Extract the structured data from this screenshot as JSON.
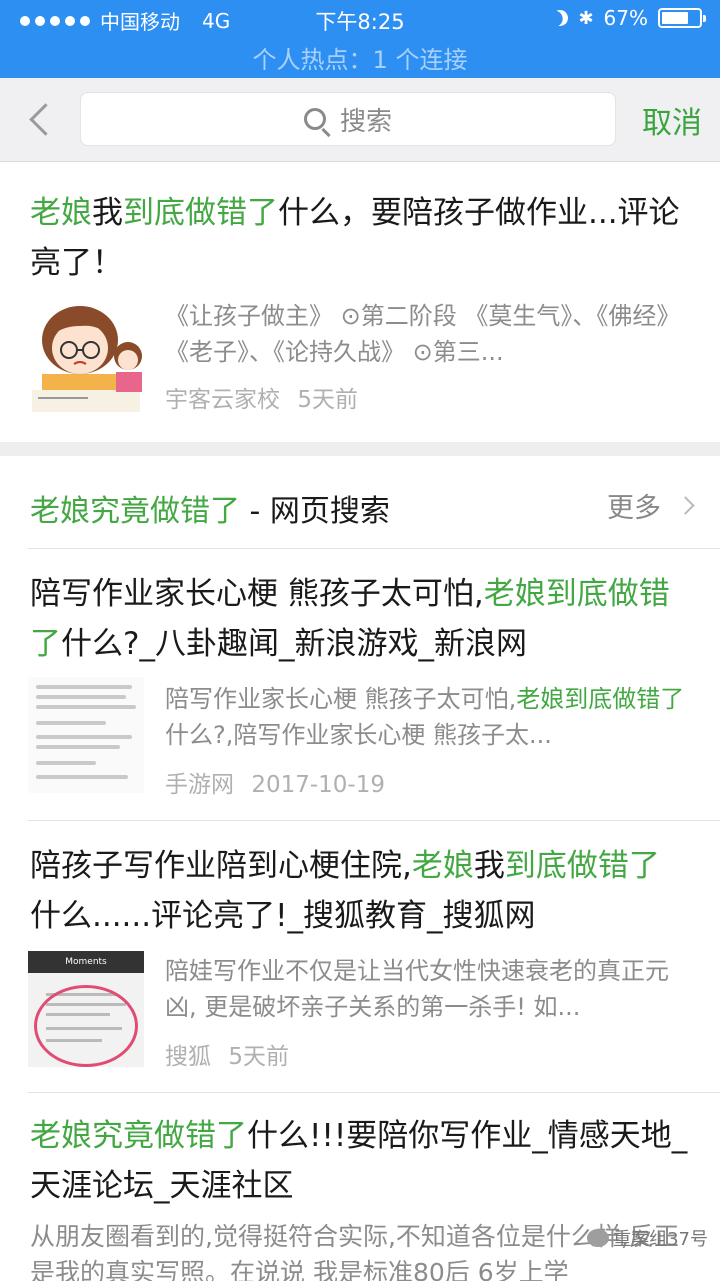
{
  "status_bar": {
    "carrier": "中国移动",
    "network": "4G",
    "time": "下午8:25",
    "battery": "67%",
    "battery_level": 0.67,
    "hotspot": "个人热点：1 个连接"
  },
  "search": {
    "placeholder": "搜索",
    "cancel_label": "取消"
  },
  "result1": {
    "title": [
      {
        "t": "老娘",
        "hl": true
      },
      {
        "t": "我",
        "hl": false
      },
      {
        "t": "到底做错了",
        "hl": true
      },
      {
        "t": "什么，要陪孩子做作业...评论亮了！",
        "hl": false
      }
    ],
    "snippet": "《让孩子做主》 ⊙第二阶段 《莫生气》、《佛经》《老子》、《论持久战》 ⊙第三...",
    "source": "宇客云家校",
    "time": "5天前"
  },
  "web_section": {
    "title_hl": "老娘究竟做错了",
    "title_rest": " - 网页搜索",
    "more_label": "更多"
  },
  "result2": {
    "title": [
      {
        "t": "陪写作业家长心梗 熊孩子太可怕,",
        "hl": false
      },
      {
        "t": "老娘到底做错了",
        "hl": true
      },
      {
        "t": "什么?_八卦趣闻_新浪游戏_新浪网",
        "hl": false
      }
    ],
    "snippet": [
      {
        "t": "陪写作业家长心梗 熊孩子太可怕,",
        "hl": false
      },
      {
        "t": "老娘到底做错了",
        "hl": true
      },
      {
        "t": "什么?,陪写作业家长心梗 熊孩子太...",
        "hl": false
      }
    ],
    "source": "手游网",
    "time": "2017-10-19"
  },
  "result3": {
    "title": [
      {
        "t": "陪孩子写作业陪到心梗住院,",
        "hl": false
      },
      {
        "t": "老娘",
        "hl": true
      },
      {
        "t": "我",
        "hl": false
      },
      {
        "t": "到底做错了",
        "hl": true
      },
      {
        "t": "什么......评论亮了!_搜狐教育_搜狐网",
        "hl": false
      }
    ],
    "snippet": "陪娃写作业不仅是让当代女性快速衰老的真正元凶, 更是破坏亲子关系的第一杀手! 如...",
    "source": "搜狐",
    "time": "5天前",
    "thumb_header": "Moments"
  },
  "result4": {
    "title": [
      {
        "t": "老娘究竟做错了",
        "hl": true
      },
      {
        "t": "什么!!!要陪你写作业_情感天地_天涯论坛_天涯社区",
        "hl": false
      }
    ],
    "snippet": "从朋友圈看到的,觉得挺符合实际,不知道各位是什么样,反正是我的真实写照。在说说 我是标准80后 6岁上学"
  },
  "watermark": "重案组37号"
}
